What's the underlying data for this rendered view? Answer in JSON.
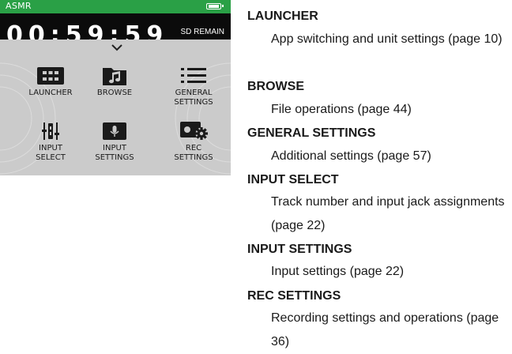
{
  "screen": {
    "app_title": "ASMR",
    "rec_time": "00:59:59",
    "remain_label": "SD REMAIN",
    "menu_items": [
      {
        "label": "LAUNCHER",
        "icon": "launcher-grid-icon"
      },
      {
        "label": "BROWSE",
        "icon": "music-folder-icon"
      },
      {
        "label": "GENERAL\nSETTINGS",
        "icon": "list-icon"
      },
      {
        "label": "INPUT\nSELECT",
        "icon": "input-select-icon"
      },
      {
        "label": "INPUT\nSETTINGS",
        "icon": "microphone-icon"
      },
      {
        "label": "REC\nSETTINGS",
        "icon": "rec-settings-gear-icon"
      }
    ],
    "colors": {
      "status_bar": "#2aa046",
      "menu_bg": "#cbcbcb",
      "rec_bar": "#0b0b0b"
    }
  },
  "descriptions": [
    {
      "heading": "LAUNCHER",
      "text": "App switching and unit settings (page 10)"
    },
    {
      "heading": "BROWSE",
      "text": "File operations (page 44)"
    },
    {
      "heading": "GENERAL SETTINGS",
      "text": "Additional settings (page 57)"
    },
    {
      "heading": "INPUT SELECT",
      "text": "Track number and input jack assignments (page 22)"
    },
    {
      "heading": "INPUT SETTINGS",
      "text": "Input settings (page 22)"
    },
    {
      "heading": "REC SETTINGS",
      "text": "Recording settings and operations (page 36)"
    }
  ]
}
